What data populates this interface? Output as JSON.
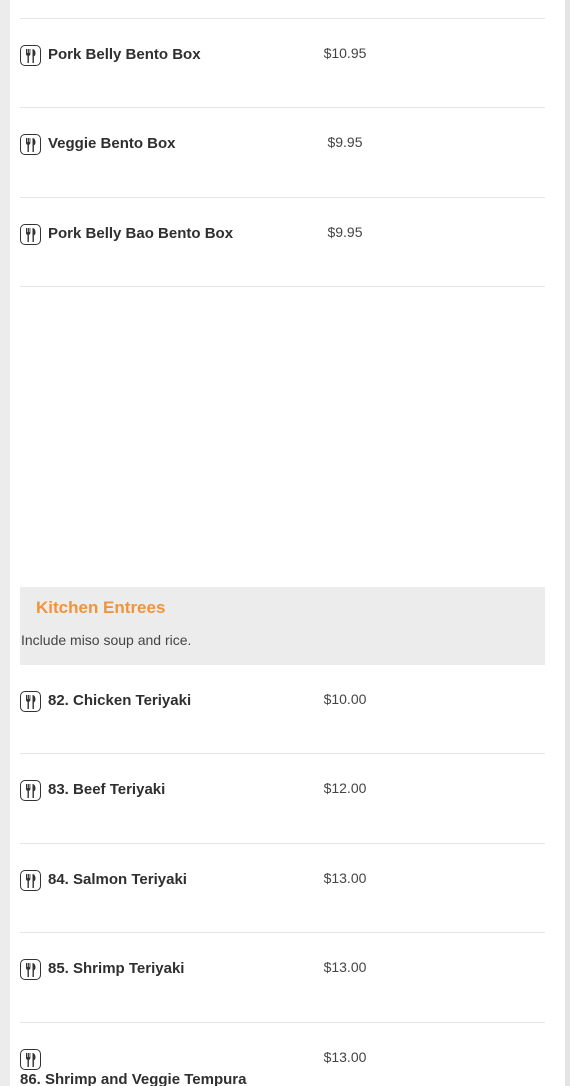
{
  "top_items": [
    {
      "name": "Pork Belly Bento Box",
      "price": "$10.95",
      "icon": "utensils-icon"
    },
    {
      "name": "Veggie Bento Box",
      "price": "$9.95",
      "icon": "utensils-icon"
    },
    {
      "name": "Pork Belly Bao Bento Box",
      "price": "$9.95",
      "icon": "utensils-icon"
    }
  ],
  "section": {
    "title": "Kitchen Entrees",
    "description": "Include miso soup and rice.",
    "title_color": "#f0943a",
    "background": "#ececec"
  },
  "section_items": [
    {
      "name": "82. Chicken Teriyaki",
      "price": "$10.00",
      "icon": "utensils-icon"
    },
    {
      "name": "83. Beef Teriyaki",
      "price": "$12.00",
      "icon": "utensils-icon"
    },
    {
      "name": "84. Salmon Teriyaki",
      "price": "$13.00",
      "icon": "utensils-icon"
    },
    {
      "name": "85. Shrimp Teriyaki",
      "price": "$13.00",
      "icon": "utensils-icon"
    },
    {
      "name": "86. Shrimp and Veggie Tempura",
      "price": "$13.00",
      "icon": "utensils-icon"
    }
  ]
}
